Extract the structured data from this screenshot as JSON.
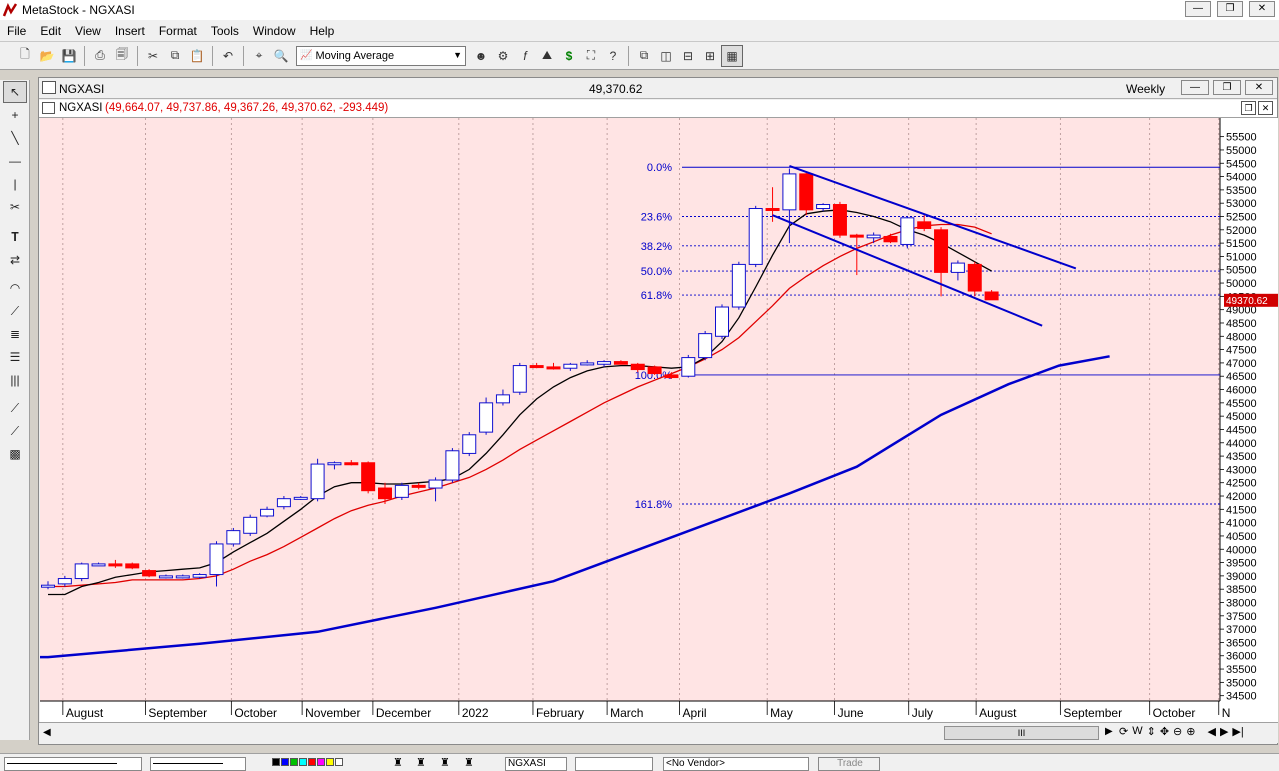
{
  "app": {
    "title": "MetaStock - NGXASI"
  },
  "window_controls": {
    "minimize": "—",
    "restore": "❐",
    "close": "✕"
  },
  "menu": [
    "File",
    "Edit",
    "View",
    "Insert",
    "Format",
    "Tools",
    "Window",
    "Help"
  ],
  "toolbar": {
    "indicator_select": "Moving Average"
  },
  "chart_window": {
    "symbol": "NGXASI",
    "last_price": "49,370.62",
    "period": "Weekly",
    "info_symbol": "NGXASI",
    "info_values": "(49,664.07, 49,737.86, 49,367.26, 49,370.62, -293.449)",
    "price_tag": "49370.62"
  },
  "scrollbar": {
    "thumb_label": "III"
  },
  "bottom": {
    "symbol_box": "NGXASI",
    "vendor_box": "<No Vendor>",
    "trade_button": "Trade"
  },
  "colors": {
    "background": "#ffe4e4",
    "up_candle": "#1010d0",
    "down_candle": "#ff0000",
    "fib": "#0000cc",
    "ma_black": "#000000",
    "ma_red": "#e00000",
    "ma_blue": "#0000cc"
  },
  "chart_data": {
    "type": "candlestick",
    "period": "Weekly",
    "x_labels": [
      "August",
      "September",
      "October",
      "November",
      "December",
      "2022",
      "February",
      "March",
      "April",
      "May",
      "June",
      "July",
      "August",
      "September",
      "October",
      "N"
    ],
    "y_ticks": [
      34500,
      35000,
      35500,
      36000,
      36500,
      37000,
      37500,
      38000,
      38500,
      39000,
      39500,
      40000,
      40500,
      41000,
      41500,
      42000,
      42500,
      43000,
      43500,
      44000,
      44500,
      45000,
      45500,
      46000,
      46500,
      47000,
      47500,
      48000,
      48500,
      49000,
      49500,
      50000,
      50500,
      51000,
      51500,
      52000,
      52500,
      53000,
      53500,
      54000,
      54500,
      55000,
      55500
    ],
    "ylim": [
      34300,
      56200
    ],
    "fibonacci": [
      {
        "label": "0.0%",
        "value": 54350
      },
      {
        "label": "23.6%",
        "value": 52500
      },
      {
        "label": "38.2%",
        "value": 51400
      },
      {
        "label": "50.0%",
        "value": 50450
      },
      {
        "label": "61.8%",
        "value": 49550
      },
      {
        "label": "100.0%",
        "value": 46550
      },
      {
        "label": "161.8%",
        "value": 41700
      }
    ],
    "candles": [
      {
        "o": 38600,
        "h": 38800,
        "l": 38500,
        "c": 38650
      },
      {
        "o": 38700,
        "h": 39000,
        "l": 38600,
        "c": 38900
      },
      {
        "o": 38900,
        "h": 39500,
        "l": 38800,
        "c": 39450
      },
      {
        "o": 39450,
        "h": 39500,
        "l": 39400,
        "c": 39450
      },
      {
        "o": 39450,
        "h": 39600,
        "l": 39300,
        "c": 39400
      },
      {
        "o": 39450,
        "h": 39500,
        "l": 39250,
        "c": 39300
      },
      {
        "o": 39200,
        "h": 39250,
        "l": 38950,
        "c": 39000
      },
      {
        "o": 38950,
        "h": 39050,
        "l": 38900,
        "c": 39000
      },
      {
        "o": 38950,
        "h": 39050,
        "l": 38900,
        "c": 39000
      },
      {
        "o": 38950,
        "h": 39100,
        "l": 38900,
        "c": 39050
      },
      {
        "o": 39050,
        "h": 40300,
        "l": 38600,
        "c": 40200
      },
      {
        "o": 40200,
        "h": 40800,
        "l": 40100,
        "c": 40700
      },
      {
        "o": 40600,
        "h": 41300,
        "l": 40500,
        "c": 41200
      },
      {
        "o": 41250,
        "h": 41600,
        "l": 41200,
        "c": 41500
      },
      {
        "o": 41600,
        "h": 42000,
        "l": 41500,
        "c": 41900
      },
      {
        "o": 41900,
        "h": 42000,
        "l": 41850,
        "c": 41950
      },
      {
        "o": 41900,
        "h": 43400,
        "l": 41800,
        "c": 43200
      },
      {
        "o": 43200,
        "h": 43300,
        "l": 43000,
        "c": 43250
      },
      {
        "o": 43250,
        "h": 43350,
        "l": 43150,
        "c": 43200
      },
      {
        "o": 43250,
        "h": 43300,
        "l": 42100,
        "c": 42200
      },
      {
        "o": 42300,
        "h": 42500,
        "l": 41700,
        "c": 41900
      },
      {
        "o": 41950,
        "h": 42500,
        "l": 41850,
        "c": 42400
      },
      {
        "o": 42400,
        "h": 42500,
        "l": 42250,
        "c": 42350
      },
      {
        "o": 42300,
        "h": 42700,
        "l": 41800,
        "c": 42600
      },
      {
        "o": 42600,
        "h": 43800,
        "l": 42500,
        "c": 43700
      },
      {
        "o": 43600,
        "h": 44400,
        "l": 43500,
        "c": 44300
      },
      {
        "o": 44400,
        "h": 45700,
        "l": 44300,
        "c": 45500
      },
      {
        "o": 45500,
        "h": 46000,
        "l": 45400,
        "c": 45800
      },
      {
        "o": 45900,
        "h": 47000,
        "l": 45800,
        "c": 46900
      },
      {
        "o": 46900,
        "h": 47000,
        "l": 46800,
        "c": 46850
      },
      {
        "o": 46850,
        "h": 47000,
        "l": 46750,
        "c": 46800
      },
      {
        "o": 46800,
        "h": 47000,
        "l": 46700,
        "c": 46950
      },
      {
        "o": 47000,
        "h": 47100,
        "l": 46900,
        "c": 47000
      },
      {
        "o": 46950,
        "h": 47100,
        "l": 46850,
        "c": 47050
      },
      {
        "o": 47050,
        "h": 47100,
        "l": 46950,
        "c": 46950
      },
      {
        "o": 46950,
        "h": 47000,
        "l": 46650,
        "c": 46750
      },
      {
        "o": 46850,
        "h": 46900,
        "l": 46550,
        "c": 46600
      },
      {
        "o": 46550,
        "h": 46650,
        "l": 46400,
        "c": 46450
      },
      {
        "o": 46500,
        "h": 47300,
        "l": 46450,
        "c": 47200
      },
      {
        "o": 47200,
        "h": 48200,
        "l": 47100,
        "c": 48100
      },
      {
        "o": 48000,
        "h": 49200,
        "l": 47900,
        "c": 49100
      },
      {
        "o": 49100,
        "h": 50800,
        "l": 49000,
        "c": 50700
      },
      {
        "o": 50700,
        "h": 52900,
        "l": 50600,
        "c": 52800
      },
      {
        "o": 52800,
        "h": 53600,
        "l": 52300,
        "c": 52750
      },
      {
        "o": 52750,
        "h": 54300,
        "l": 51500,
        "c": 54100
      },
      {
        "o": 54100,
        "h": 54150,
        "l": 52550,
        "c": 52750
      },
      {
        "o": 52800,
        "h": 53000,
        "l": 52700,
        "c": 52950
      },
      {
        "o": 52950,
        "h": 53050,
        "l": 51700,
        "c": 51800
      },
      {
        "o": 51800,
        "h": 51850,
        "l": 50300,
        "c": 51750
      },
      {
        "o": 51700,
        "h": 51900,
        "l": 51500,
        "c": 51800
      },
      {
        "o": 51750,
        "h": 51850,
        "l": 51500,
        "c": 51550
      },
      {
        "o": 51450,
        "h": 52500,
        "l": 51300,
        "c": 52450
      },
      {
        "o": 52300,
        "h": 52600,
        "l": 51950,
        "c": 52050
      },
      {
        "o": 52000,
        "h": 52100,
        "l": 49500,
        "c": 50400
      },
      {
        "o": 50400,
        "h": 50850,
        "l": 50100,
        "c": 50750
      },
      {
        "o": 50700,
        "h": 50800,
        "l": 49500,
        "c": 49700
      },
      {
        "o": 49664.07,
        "h": 49737.86,
        "l": 49367.26,
        "c": 49370.62
      }
    ],
    "ma_black": [
      38300,
      38300,
      38600,
      38750,
      38950,
      39050,
      39150,
      39200,
      39250,
      39300,
      39500,
      39900,
      40250,
      40600,
      41050,
      41500,
      42000,
      42350,
      42500,
      42500,
      42450,
      42450,
      42500,
      42550,
      42650,
      43000,
      43600,
      44300,
      45050,
      45650,
      46100,
      46450,
      46700,
      46850,
      46900,
      46900,
      46850,
      46800,
      46850,
      47200,
      47800,
      48700,
      49850,
      51050,
      52150,
      52600,
      52700,
      52750,
      52650,
      52500,
      52300,
      52000,
      51800,
      51500,
      51150,
      50800,
      50450
    ],
    "ma_red": [
      38600,
      38600,
      38650,
      38700,
      38750,
      38850,
      38850,
      38850,
      38850,
      38900,
      39000,
      39250,
      39550,
      39800,
      40100,
      40450,
      40800,
      41150,
      41450,
      41650,
      41800,
      42000,
      42150,
      42300,
      42500,
      42700,
      43000,
      43350,
      43750,
      44100,
      44450,
      44800,
      45150,
      45500,
      45800,
      46100,
      46350,
      46600,
      46850,
      47150,
      47500,
      47950,
      48550,
      49150,
      49800,
      50250,
      50650,
      51000,
      51300,
      51550,
      51800,
      52000,
      52150,
      52200,
      52200,
      52100,
      51850
    ],
    "ma_blue": [
      [
        0,
        35950
      ],
      [
        9,
        36450
      ],
      [
        16,
        36900
      ],
      [
        23,
        37800
      ],
      [
        30,
        38800
      ],
      [
        37,
        40450
      ],
      [
        44,
        42100
      ],
      [
        48,
        43100
      ],
      [
        53,
        45050
      ],
      [
        57,
        46200
      ],
      [
        60,
        46900
      ],
      [
        63,
        47250
      ]
    ],
    "trendlines": [
      [
        [
          44,
          54400
        ],
        [
          61,
          50550
        ]
      ],
      [
        [
          43,
          52550
        ],
        [
          59,
          48400
        ]
      ]
    ]
  }
}
